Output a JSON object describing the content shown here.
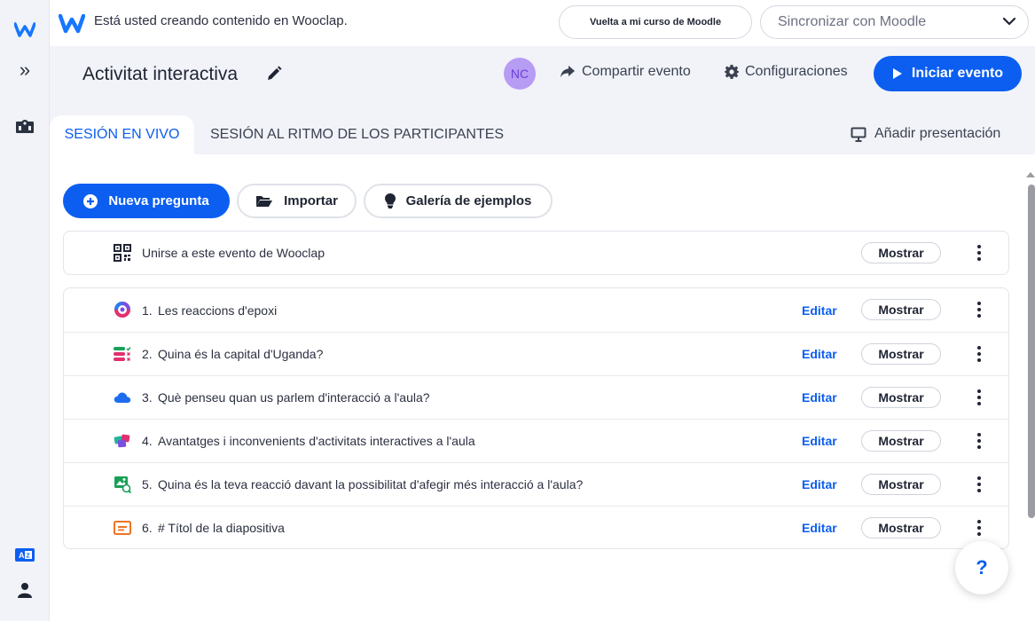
{
  "rail": {
    "logo_icon": "wooclap-logo-icon",
    "expand_icon": "double-chevron-right-icon",
    "map_icon": "map-icon",
    "lang_icon": "language-icon",
    "user_icon": "user-icon",
    "expand_glyph": "»"
  },
  "topbar": {
    "notice": "Está usted creando contenido en Wooclap.",
    "moodle_button": "Vuelta a mi curso de Moodle",
    "sync_select_value": "Sincronizar con Moodle"
  },
  "header": {
    "title": "Activitat interactiva",
    "avatar_initials": "NC",
    "share_label": "Compartir evento",
    "config_label": "Configuraciones",
    "start_label": "Iniciar evento"
  },
  "tabs": {
    "live": "SESIÓN EN VIVO",
    "self_paced": "SESIÓN AL RITMO DE LOS PARTICIPANTES",
    "add_presentation": "Añadir presentación"
  },
  "toolbar": {
    "new_question": "Nueva pregunta",
    "import": "Importar",
    "gallery": "Galería de ejemplos"
  },
  "join": {
    "label": "Unirse a este evento de Wooclap",
    "show": "Mostrar",
    "icon": "qr-code-icon"
  },
  "questions": [
    {
      "number": "1.",
      "text": "Les reaccions d'epoxi",
      "icon": "poll-ring-icon",
      "edit": "Editar",
      "show": "Mostrar"
    },
    {
      "number": "2.",
      "text": "Quina és la capital d'Uganda?",
      "icon": "multiple-choice-icon",
      "edit": "Editar",
      "show": "Mostrar"
    },
    {
      "number": "3.",
      "text": "Què penseu quan us parlem d'interacció a l'aula?",
      "icon": "word-cloud-icon",
      "edit": "Editar",
      "show": "Mostrar"
    },
    {
      "number": "4.",
      "text": "Avantatges i inconvenients d'activitats interactives a l'aula",
      "icon": "brainstorm-icon",
      "edit": "Editar",
      "show": "Mostrar"
    },
    {
      "number": "5.",
      "text": "Quina és la teva reacció davant la possibilitat d'afegir més interacció a l'aula?",
      "icon": "image-reaction-icon",
      "edit": "Editar",
      "show": "Mostrar"
    },
    {
      "number": "6.",
      "text": "# Títol de la diapositiva",
      "icon": "slide-icon",
      "edit": "Editar",
      "show": "Mostrar"
    }
  ],
  "help": {
    "label": "?"
  },
  "colors": {
    "accent": "#0b5ef0",
    "avatar_bg": "#b79cf4",
    "avatar_text": "#6a3fd9",
    "rail_bg": "#f1f3f8"
  }
}
